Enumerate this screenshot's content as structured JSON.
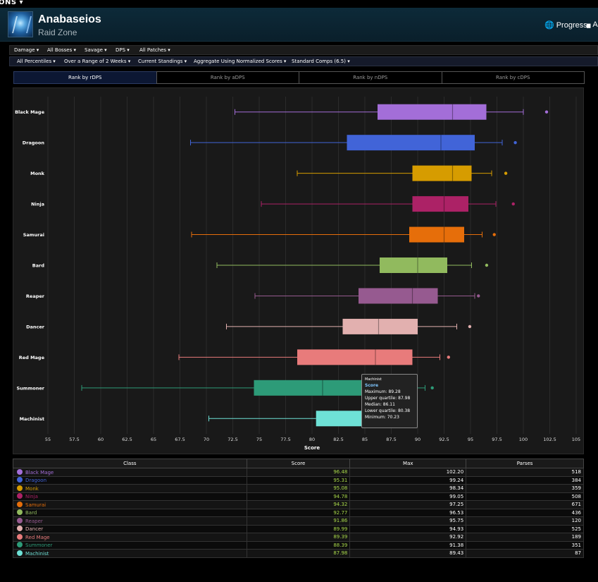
{
  "topbar": {
    "label": "ONS ▾"
  },
  "header": {
    "title": "Anabaseios",
    "subtitle": "Raid Zone",
    "links": [
      {
        "icon": "globe-icon",
        "glyph": "🌐",
        "label": "Progress"
      },
      {
        "icon": "box-icon",
        "glyph": "▆",
        "label": "A"
      }
    ]
  },
  "filters_row1": [
    "Damage ▾",
    "All Bosses ▾",
    "Savage ▾",
    "DPS ▾",
    "All Patches ▾"
  ],
  "filters_row2": [
    "All Percentiles ▾",
    "Over a Range of 2 Weeks ▾",
    "Current Standings ▾",
    "Aggregate Using Normalized Scores ▾",
    "Standard Comps (6.5) ▾"
  ],
  "tabs": [
    "Rank by rDPS",
    "Rank by aDPS",
    "Rank by nDPS",
    "Rank by cDPS"
  ],
  "active_tab": 0,
  "chart_data": {
    "type": "boxplot",
    "xlabel": "Score",
    "xlim": [
      55,
      105
    ],
    "xticks": [
      "55",
      "57.5",
      "60",
      "62.5",
      "65",
      "67.5",
      "70",
      "72.5",
      "75",
      "77.5",
      "80",
      "82.5",
      "85",
      "87.5",
      "90",
      "92.5",
      "95",
      "97.5",
      "100",
      "102.5",
      "105"
    ],
    "grid": true,
    "series": [
      {
        "name": "Black Mage",
        "color": "#a36ed8",
        "min": 72.7,
        "q1": 86.2,
        "median": 93.3,
        "q3": 96.5,
        "max": 100.0,
        "outlier": 102.2
      },
      {
        "name": "Dragoon",
        "color": "#4164d8",
        "min": 68.5,
        "q1": 83.3,
        "median": 92.2,
        "q3": 95.4,
        "max": 98.0,
        "outlier": 99.24
      },
      {
        "name": "Monk",
        "color": "#d69c00",
        "min": 78.6,
        "q1": 89.5,
        "median": 93.3,
        "q3": 95.1,
        "max": 97.0,
        "outlier": 98.34
      },
      {
        "name": "Ninja",
        "color": "#ac2266",
        "min": 75.2,
        "q1": 89.5,
        "median": 92.5,
        "q3": 94.8,
        "max": 97.4,
        "outlier": 99.05
      },
      {
        "name": "Samurai",
        "color": "#e66e0a",
        "min": 68.6,
        "q1": 89.2,
        "median": 92.5,
        "q3": 94.4,
        "max": 96.1,
        "outlier": 97.25
      },
      {
        "name": "Bard",
        "color": "#91ba5e",
        "min": 71.0,
        "q1": 86.4,
        "median": 90.0,
        "q3": 92.8,
        "max": 95.1,
        "outlier": 96.53
      },
      {
        "name": "Reaper",
        "color": "#965a90",
        "min": 74.6,
        "q1": 84.4,
        "median": 89.5,
        "q3": 91.9,
        "max": 95.4,
        "outlier": 95.75
      },
      {
        "name": "Dancer",
        "color": "#e2b0af",
        "min": 71.9,
        "q1": 82.9,
        "median": 86.3,
        "q3": 90.0,
        "max": 93.7,
        "outlier": 94.93
      },
      {
        "name": "Red Mage",
        "color": "#e87b7b",
        "min": 67.4,
        "q1": 78.6,
        "median": 86.0,
        "q3": 89.5,
        "max": 92.1,
        "outlier": 92.92
      },
      {
        "name": "Summoner",
        "color": "#2d9b78",
        "min": 58.2,
        "q1": 74.5,
        "median": 81.0,
        "q3": 87.0,
        "max": 90.7,
        "outlier": 91.38
      },
      {
        "name": "Machinist",
        "color": "#6ee1d6",
        "min": 70.23,
        "q1": 80.38,
        "median": 86.11,
        "q3": 87.98,
        "max": 89.28
      }
    ]
  },
  "tooltip": {
    "title": "Machinist",
    "series": "Score",
    "lines": [
      "Maximum: 89.28",
      "Upper quartile: 87.98",
      "Median: 86.11",
      "Lower quartile: 80.38",
      "Minimum: 70.23"
    ]
  },
  "table": {
    "headers": [
      "Class",
      "Score",
      "Max",
      "Parses"
    ],
    "rows": [
      {
        "class": "Black Mage",
        "color": "#a36ed8",
        "icon": "black-mage-icon",
        "score": "96.48",
        "max": "102.20",
        "parses": "518"
      },
      {
        "class": "Dragoon",
        "color": "#4164d8",
        "icon": "dragoon-icon",
        "score": "95.31",
        "max": "99.24",
        "parses": "384"
      },
      {
        "class": "Monk",
        "color": "#d69c00",
        "icon": "monk-icon",
        "score": "95.08",
        "max": "98.34",
        "parses": "359"
      },
      {
        "class": "Ninja",
        "color": "#ac2266",
        "icon": "ninja-icon",
        "score": "94.78",
        "max": "99.05",
        "parses": "508"
      },
      {
        "class": "Samurai",
        "color": "#e66e0a",
        "icon": "samurai-icon",
        "score": "94.32",
        "max": "97.25",
        "parses": "671"
      },
      {
        "class": "Bard",
        "color": "#91ba5e",
        "icon": "bard-icon",
        "score": "92.77",
        "max": "96.53",
        "parses": "436"
      },
      {
        "class": "Reaper",
        "color": "#965a90",
        "icon": "reaper-icon",
        "score": "91.86",
        "max": "95.75",
        "parses": "120"
      },
      {
        "class": "Dancer",
        "color": "#e2b0af",
        "icon": "dancer-icon",
        "score": "89.99",
        "max": "94.93",
        "parses": "525"
      },
      {
        "class": "Red Mage",
        "color": "#e87b7b",
        "icon": "red-mage-icon",
        "score": "89.39",
        "max": "92.92",
        "parses": "189"
      },
      {
        "class": "Summoner",
        "color": "#2d9b78",
        "icon": "summoner-icon",
        "score": "88.39",
        "max": "91.38",
        "parses": "351"
      },
      {
        "class": "Machinist",
        "color": "#6ee1d6",
        "icon": "machinist-icon",
        "score": "87.98",
        "max": "89.43",
        "parses": "87"
      }
    ]
  }
}
